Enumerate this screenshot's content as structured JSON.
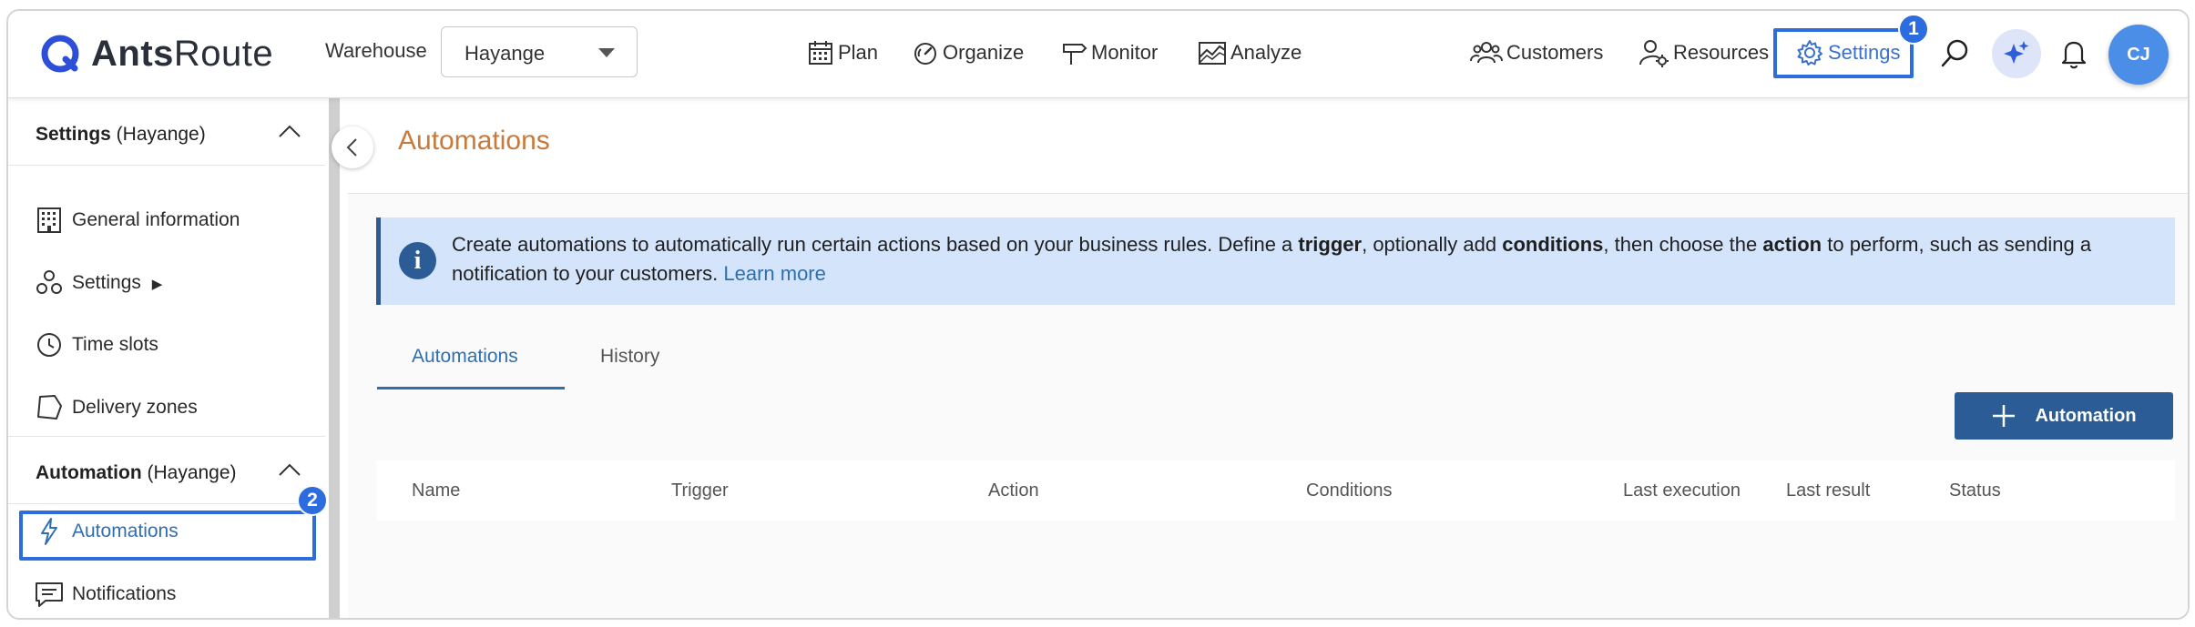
{
  "app": {
    "logo_bold": "Ants",
    "logo_light": "Route"
  },
  "header": {
    "warehouse_label": "Warehouse",
    "warehouse_value": "Hayange",
    "nav": {
      "plan": "Plan",
      "organize": "Organize",
      "monitor": "Monitor",
      "analyze": "Analyze",
      "customers": "Customers",
      "resources": "Resources",
      "settings": "Settings"
    },
    "settings_badge": "1",
    "avatar_initials": "CJ"
  },
  "sidebar": {
    "section1": {
      "title_bold": "Settings",
      "title_rest": " (Hayange)"
    },
    "items1": [
      {
        "label": "General information"
      },
      {
        "label": "Settings",
        "suffix": "▶"
      },
      {
        "label": "Time slots"
      },
      {
        "label": "Delivery zones"
      }
    ],
    "section2": {
      "title_bold": "Automation",
      "title_rest": " (Hayange)"
    },
    "items2": [
      {
        "label": "Automations"
      },
      {
        "label": "Notifications"
      }
    ],
    "active_badge": "2"
  },
  "main": {
    "page_title": "Automations",
    "info": {
      "p1": "Create automations to automatically run certain actions based on your business rules. Define a ",
      "b1": "trigger",
      "p2": ", optionally add ",
      "b2": "conditions",
      "p3": ", then choose the ",
      "b3": "action",
      "p4": " to perform, such as sending a notification to your customers. ",
      "link": "Learn more"
    },
    "tabs": [
      {
        "label": "Automations",
        "active": true
      },
      {
        "label": "History",
        "active": false
      }
    ],
    "add_button": "Automation",
    "table_headers": [
      "Name",
      "Trigger",
      "Action",
      "Conditions",
      "Last execution",
      "Last result",
      "Status"
    ]
  },
  "colors": {
    "accent": "#2d6cdf",
    "primary": "#2b5c95",
    "title": "#c97a3a",
    "info_bg": "#d4e5fb"
  }
}
